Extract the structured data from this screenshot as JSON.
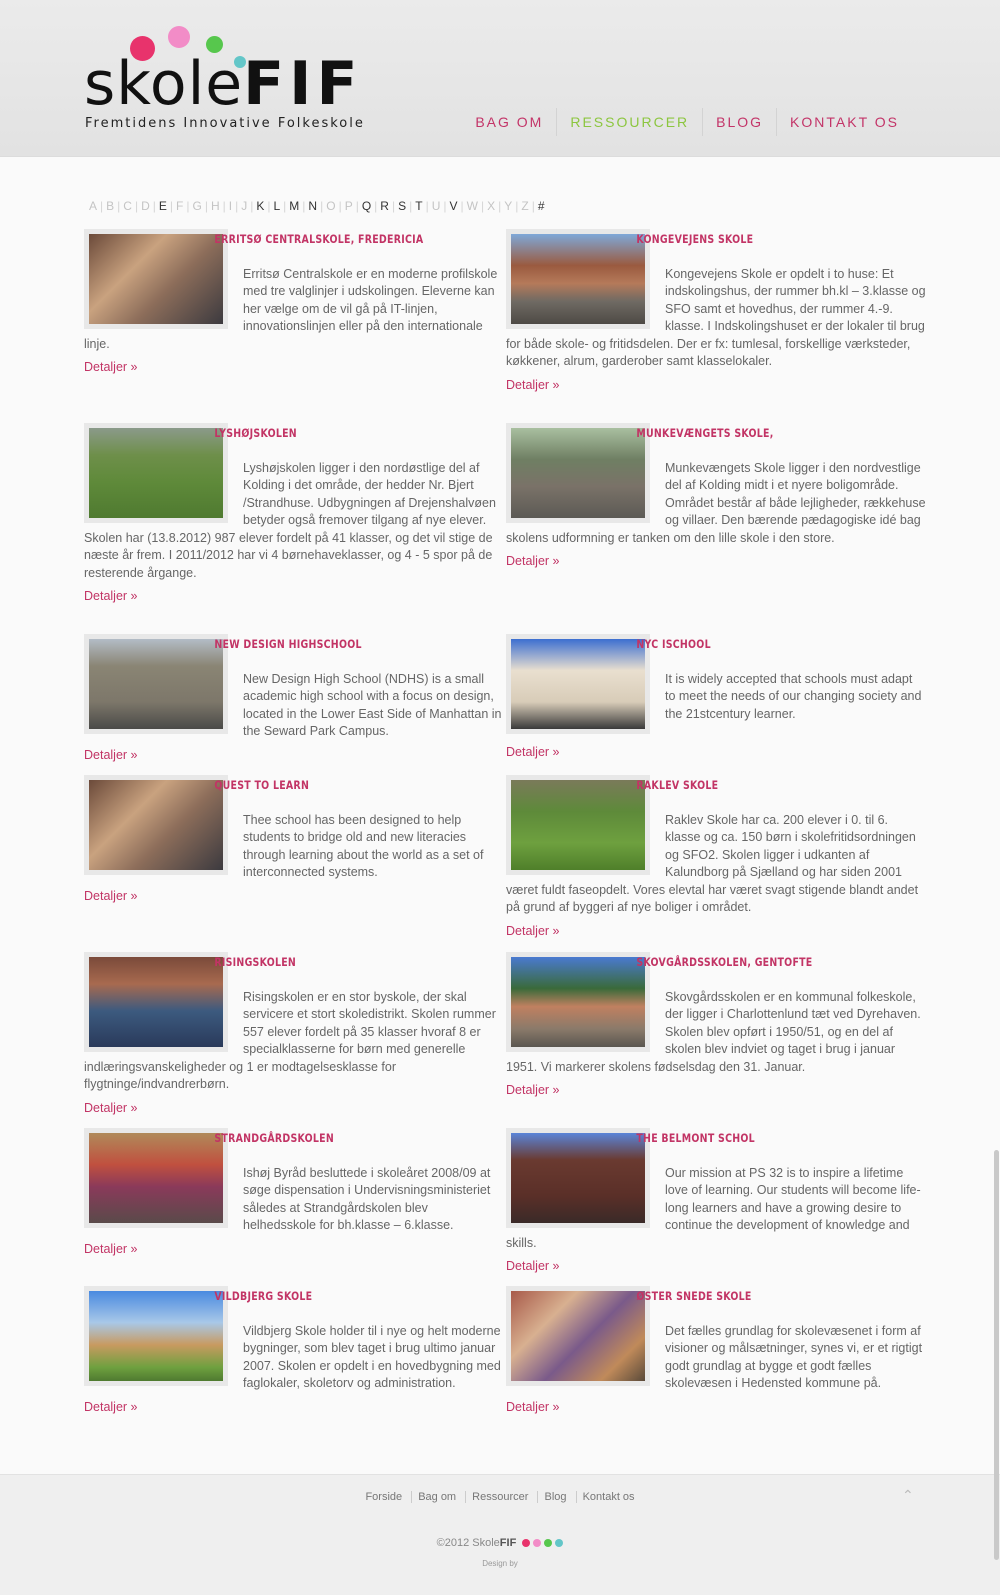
{
  "logo": {
    "name_light": "skole",
    "name_bold": "FIF",
    "tagline": "Fremtidens Innovative Folkeskole",
    "dot_colors": [
      "#e8336c",
      "#f28cc7",
      "#57c74d",
      "#63c6c8"
    ]
  },
  "nav": [
    {
      "label": "BAG OM"
    },
    {
      "label": "RESSOURCER"
    },
    {
      "label": "BLOG"
    },
    {
      "label": "KONTAKT OS"
    }
  ],
  "alphabet": [
    {
      "l": "A",
      "on": false
    },
    {
      "l": "B",
      "on": false
    },
    {
      "l": "C",
      "on": false
    },
    {
      "l": "D",
      "on": false
    },
    {
      "l": "E",
      "on": true
    },
    {
      "l": "F",
      "on": false
    },
    {
      "l": "G",
      "on": false
    },
    {
      "l": "H",
      "on": false
    },
    {
      "l": "I",
      "on": false
    },
    {
      "l": "J",
      "on": false
    },
    {
      "l": "K",
      "on": true
    },
    {
      "l": "L",
      "on": true
    },
    {
      "l": "M",
      "on": true
    },
    {
      "l": "N",
      "on": true
    },
    {
      "l": "O",
      "on": false
    },
    {
      "l": "P",
      "on": false
    },
    {
      "l": "Q",
      "on": true
    },
    {
      "l": "R",
      "on": true
    },
    {
      "l": "S",
      "on": true
    },
    {
      "l": "T",
      "on": true
    },
    {
      "l": "U",
      "on": false
    },
    {
      "l": "V",
      "on": true
    },
    {
      "l": "W",
      "on": false
    },
    {
      "l": "X",
      "on": false
    },
    {
      "l": "Y",
      "on": false
    },
    {
      "l": "Z",
      "on": false
    },
    {
      "l": "#",
      "on": true
    }
  ],
  "details_label": "Detaljer »",
  "schools": [
    {
      "title": "Erritsø Centralskole, Fredericia",
      "desc": "Erritsø Centralskole er en moderne profilskole med tre valglinjer i udskolingen. Eleverne kan her vælge om de vil gå på IT-linjen, innovationslinjen eller på den internationale linje.",
      "photo": "classroom-photo"
    },
    {
      "title": "Kongevejens Skole",
      "desc": "Kongevejens Skole er opdelt i to huse: Et indskolingshus, der rummer bh.kl – 3.klasse og SFO samt et hovedhus, der rummer 4.-9. klasse. I Indskolingshuset er der lokaler til brug for både skole- og fritidsdelen. Der er fx: tumlesal, forskellige værksteder, køkkener, alrum, garderober samt klasselokaler.",
      "photo": "schoolyard-photo"
    },
    {
      "title": "Lyshøjskolen",
      "desc": "Lyshøjskolen ligger i den nordøstlige del af Kolding i det område, der hedder Nr. Bjert /Strandhuse. Udbygningen af Drejenshalvøen betyder også fremover tilgang af nye elever. Skolen har (13.8.2012) 987 elever fordelt på 41 klasser, og det vil stige de næste år frem. I 2011/2012 har vi 4 børnehaveklasser, og 4 - 5 spor på de resterende årgange.",
      "photo": "outdoor-class-photo"
    },
    {
      "title": "Munkevængets Skole,",
      "desc": "Munkevængets Skole ligger i den nordvestlige del af Kolding midt i et nyere boligområde. Området består af både lejligheder, rækkehuse og villaer. Den bærende pædagogiske idé bag skolens udformning er tanken om den lille skole i den store.",
      "photo": "playground-photo"
    },
    {
      "title": "New Design Highschool",
      "desc": "New Design High School (NDHS) is a small academic high school with a focus on design, located in the Lower East Side of Manhattan in the Seward Park Campus.",
      "photo": "building-photo"
    },
    {
      "title": "NYC ISchool",
      "desc": "It is widely accepted that schools must adapt to meet the needs of our changing society and the 21stcentury learner.",
      "photo": "city-building-photo"
    },
    {
      "title": "Quest to Learn",
      "desc": "Thee school has been designed to help students to bridge old and new literacies through learning about the world as a set of interconnected systems.",
      "photo": "classroom-photo"
    },
    {
      "title": "Raklev Skole",
      "desc": "Raklev Skole har ca. 200 elever i 0. til 6. klasse og ca. 150 børn i skolefritidsordningen og SFO2. Skolen ligger i udkanten af Kalundborg på Sjælland og har siden 2001 været fuldt faseopdelt. Vores elevtal har været svagt stigende blandt andet på grund af byggeri af nye boliger i området.",
      "photo": "field-photo"
    },
    {
      "title": "Risingskolen",
      "desc": "Risingskolen er en stor byskole, der skal servicere et stort skoledistrikt. Skolen rummer 557 elever fordelt på 35 klasser hvoraf 8 er specialklasserne for børn med generelle indlæringsvanskeligheder og 1 er modtagelsesklasse for flygtninge/indvandrerbørn.",
      "photo": "auditorium-photo"
    },
    {
      "title": "Skovgårdsskolen, Gentofte",
      "desc": "Skovgårdsskolen er en kommunal folkeskole, der ligger i Charlottenlund tæt ved Dyrehaven. Skolen blev opført i 1950/51, og en del af skolen blev indviet og taget i brug i januar 1951. Vi markerer skolens fødselsdag den 31. Januar.",
      "photo": "school-building-photo"
    },
    {
      "title": "Strandgårdskolen",
      "desc": "Ishøj Byråd besluttede i skoleåret 2008/09 at søge dispensation i Undervisningsministeriet således at Strandgårdskolen blev helhedsskole for bh.klasse – 6.klasse.",
      "photo": "crowd-photo"
    },
    {
      "title": "The Belmont Schol",
      "desc": "Our mission at PS 32 is to inspire a lifetime love of learning. Our students will become life-long learners and have a growing desire to continue the development of knowledge and skills.",
      "photo": "brick-building-photo"
    },
    {
      "title": "Vildbjerg Skole",
      "desc": "Vildbjerg Skole holder til i nye og helt moderne bygninger, som blev taget i brug ultimo januar 2007. Skolen er opdelt i en hovedbygning med faglokaler, skoletorv og administration.",
      "photo": "modern-building-photo"
    },
    {
      "title": "Øster Snede Skole",
      "desc": "Det fælles grundlag for skolevæsenet i form af visioner og målsætninger, synes vi, er et rigtigt godt grundlag at bygge et godt fælles skolevæsen i Hedensted kommune på.",
      "photo": "kids-group-photo"
    }
  ],
  "footer": {
    "links": [
      "Forside",
      "Bag om",
      "Ressourcer",
      "Blog",
      "Kontakt os"
    ],
    "copyright_prefix": "©2012 Skole",
    "copyright_bold": "FIF",
    "design_by": "Design by"
  }
}
